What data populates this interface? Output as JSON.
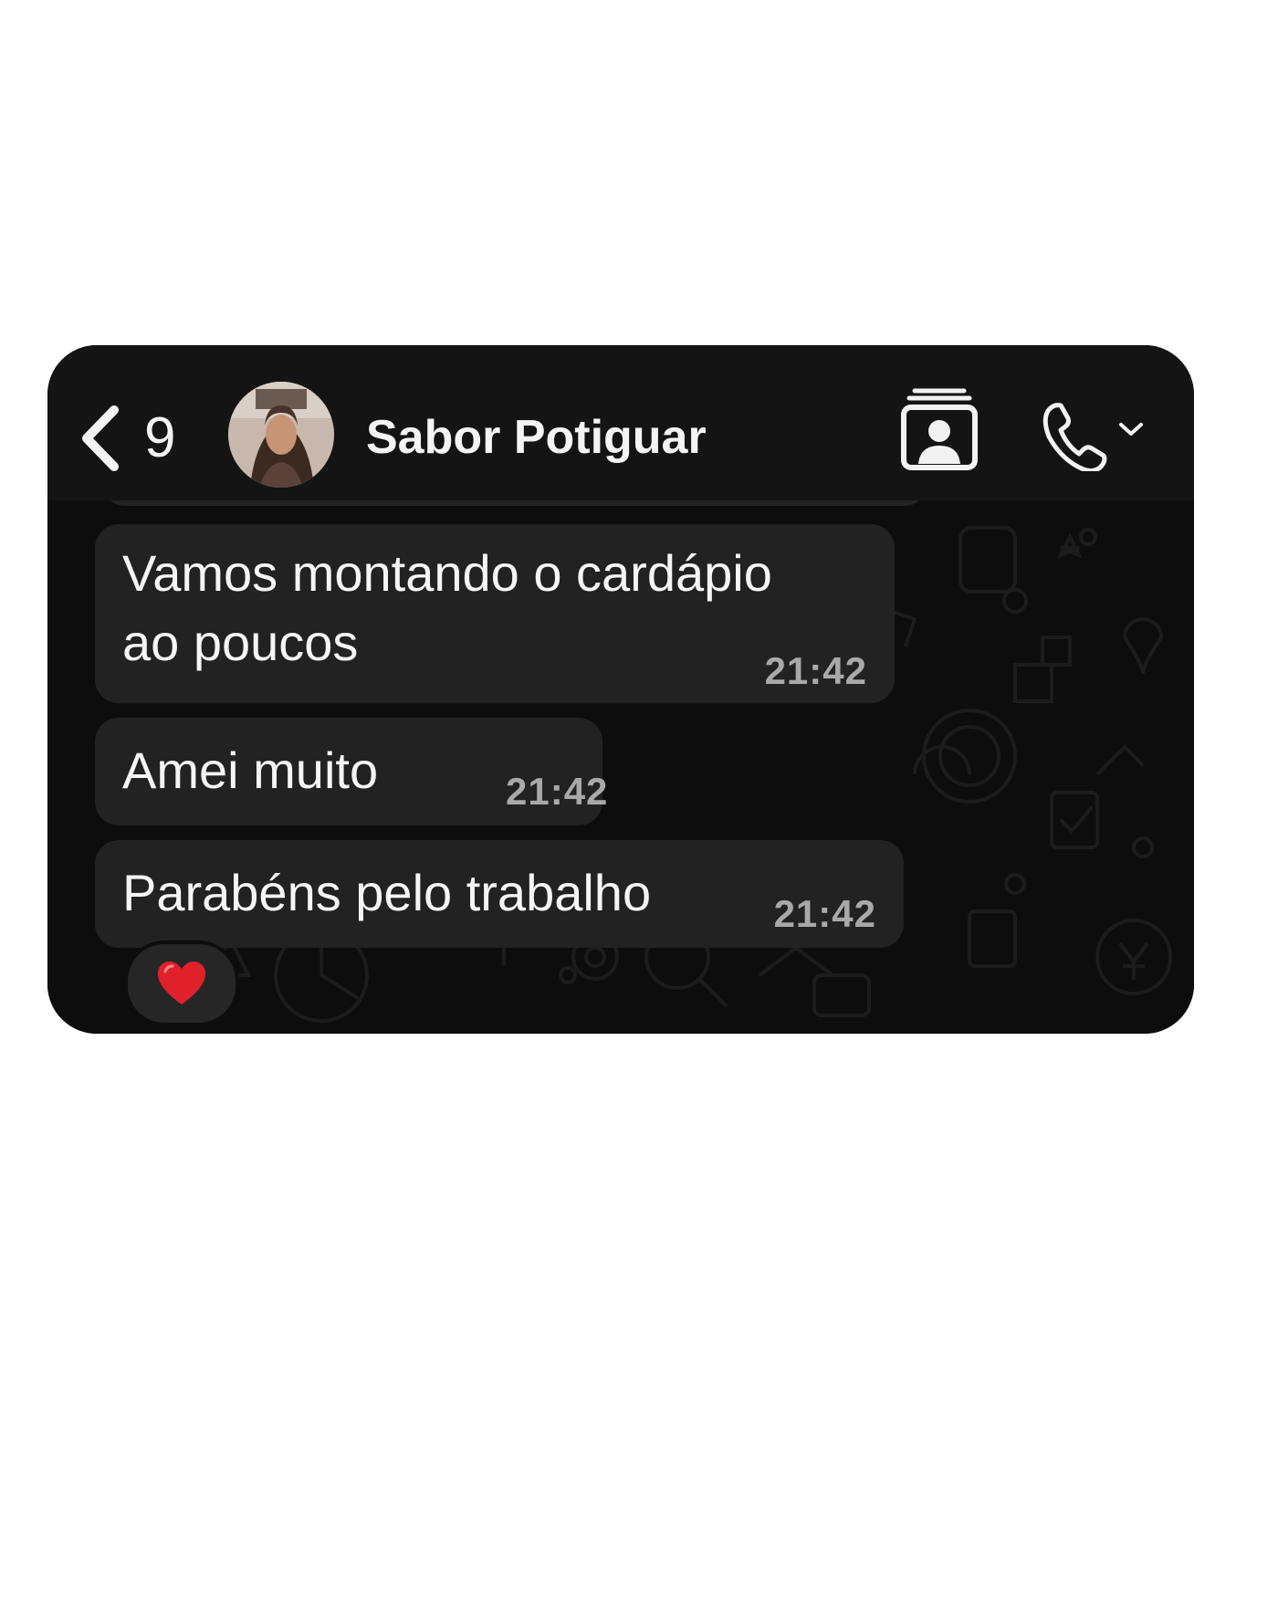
{
  "header": {
    "back_label": "Back",
    "unread_count": "9",
    "contact_name": "Sabor Potiguar",
    "icons": [
      "chevron-left-icon",
      "avatar",
      "contact-card-icon",
      "phone-icon",
      "chevron-down-icon"
    ]
  },
  "messages": [
    {
      "lines": [
        "Vamos montando o cardápio",
        "ao poucos"
      ],
      "time": "21:42"
    },
    {
      "lines": [
        "Amei muito"
      ],
      "time": "21:42"
    },
    {
      "lines": [
        "Parabéns pelo trabalho"
      ],
      "time": "21:42"
    }
  ],
  "reaction": {
    "emoji": "heart-icon",
    "color": "#e0202b"
  },
  "colors": {
    "background": "#0b0b0b",
    "header": "#141414",
    "bubble": "#222222",
    "text": "#f5f5f5",
    "timestamp": "#a9a9a9",
    "page": "#ffffff"
  }
}
